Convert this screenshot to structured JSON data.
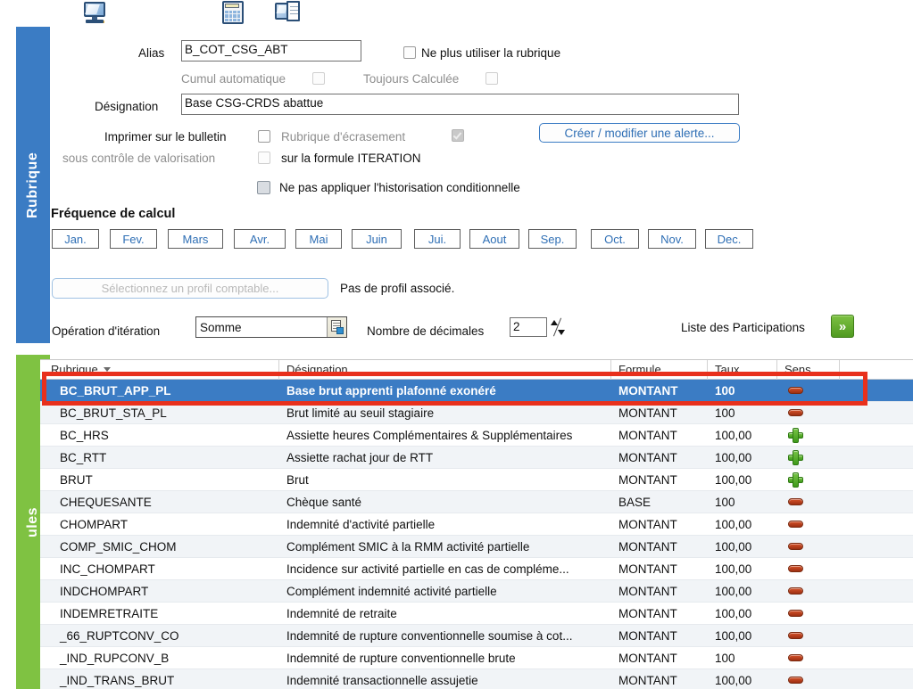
{
  "sidebar": {
    "tabs": [
      {
        "label": "Rubrique",
        "color": "#3b7cc4"
      },
      {
        "label": "ules",
        "color": "#7fc242"
      }
    ]
  },
  "toolbar": {
    "icons": [
      {
        "name": "monitor-icon"
      },
      {
        "name": "calculator-icon"
      },
      {
        "name": "window-icon"
      }
    ]
  },
  "form": {
    "alias_label": "Alias",
    "alias_value": "B_COT_CSG_ABT",
    "ne_plus_utiliser_label": "Ne plus utiliser la rubrique",
    "cumul_automatique_label": "Cumul automatique",
    "toujours_calculee_label": "Toujours Calculée",
    "designation_label": "Désignation",
    "designation_value": "Base CSG-CRDS abattue",
    "imprimer_label": "Imprimer sur le bulletin",
    "sous_controle_label": "sous contrôle de valorisation",
    "rubrique_ecrasement_label": "Rubrique d'écrasement",
    "sur_formule_label": "sur la formule ITERATION",
    "historisation_label": "Ne pas appliquer l'historisation conditionnelle",
    "alerte_button": "Créer / modifier une alerte..."
  },
  "frequence": {
    "title": "Fréquence de calcul",
    "months": [
      "Jan.",
      "Fev.",
      "Mars",
      "Avr.",
      "Mai",
      "Juin",
      "Jui.",
      "Aout",
      "Sep.",
      "Oct.",
      "Nov.",
      "Dec."
    ]
  },
  "profil": {
    "button_label": "Sélectionnez un profil comptable...",
    "status_text": "Pas de profil associé."
  },
  "iteration": {
    "operation_label": "Opération d'itération",
    "operation_value": "Somme",
    "decimales_label": "Nombre de décimales",
    "decimales_value": "2",
    "participations_label": "Liste des Participations",
    "participations_button": "»"
  },
  "grid": {
    "columns": [
      "Rubrique",
      "Désignation",
      "Formule",
      "Taux",
      "Sens"
    ],
    "sort_column": "Rubrique",
    "rows": [
      {
        "rubrique": "BC_BRUT_APP_PL",
        "designation": "Base brut apprenti plafonné exonéré",
        "formule": "MONTANT",
        "taux": "100",
        "sens": "minus",
        "selected": true
      },
      {
        "rubrique": "BC_BRUT_STA_PL",
        "designation": "Brut limité au seuil stagiaire",
        "formule": "MONTANT",
        "taux": "100",
        "sens": "minus",
        "selected": false
      },
      {
        "rubrique": "BC_HRS",
        "designation": "Assiette heures Complémentaires & Supplémentaires",
        "formule": "MONTANT",
        "taux": "100,00",
        "sens": "plus",
        "selected": false
      },
      {
        "rubrique": "BC_RTT",
        "designation": "Assiette rachat jour de RTT",
        "formule": "MONTANT",
        "taux": "100,00",
        "sens": "plus",
        "selected": false
      },
      {
        "rubrique": "BRUT",
        "designation": "Brut",
        "formule": "MONTANT",
        "taux": "100,00",
        "sens": "plus",
        "selected": false
      },
      {
        "rubrique": "CHEQUESANTE",
        "designation": "Chèque santé",
        "formule": "BASE",
        "taux": "100",
        "sens": "minus",
        "selected": false
      },
      {
        "rubrique": "CHOMPART",
        "designation": "Indemnité d'activité partielle",
        "formule": "MONTANT",
        "taux": "100,00",
        "sens": "minus",
        "selected": false
      },
      {
        "rubrique": "COMP_SMIC_CHOM",
        "designation": "Complément SMIC à la RMM activité partielle",
        "formule": "MONTANT",
        "taux": "100,00",
        "sens": "minus",
        "selected": false
      },
      {
        "rubrique": "INC_CHOMPART",
        "designation": "Incidence sur activité partielle en cas de compléme...",
        "formule": "MONTANT",
        "taux": "100,00",
        "sens": "minus",
        "selected": false
      },
      {
        "rubrique": "INDCHOMPART",
        "designation": "Complément indemnité activité partielle",
        "formule": "MONTANT",
        "taux": "100,00",
        "sens": "minus",
        "selected": false
      },
      {
        "rubrique": "INDEMRETRAITE",
        "designation": "Indemnité de retraite",
        "formule": "MONTANT",
        "taux": "100,00",
        "sens": "minus",
        "selected": false
      },
      {
        "rubrique": "_66_RUPTCONV_CO",
        "designation": "Indemnité de rupture conventionnelle soumise à cot...",
        "formule": "MONTANT",
        "taux": "100,00",
        "sens": "minus",
        "selected": false
      },
      {
        "rubrique": "_IND_RUPCONV_B",
        "designation": "Indemnité de rupture conventionnelle brute",
        "formule": "MONTANT",
        "taux": "100",
        "sens": "minus",
        "selected": false
      },
      {
        "rubrique": "_IND_TRANS_BRUT",
        "designation": "Indemnité transactionnelle assujetie",
        "formule": "MONTANT",
        "taux": "100,00",
        "sens": "minus",
        "selected": false
      }
    ]
  },
  "annotation": {
    "highlight_color": "#e8301c"
  }
}
